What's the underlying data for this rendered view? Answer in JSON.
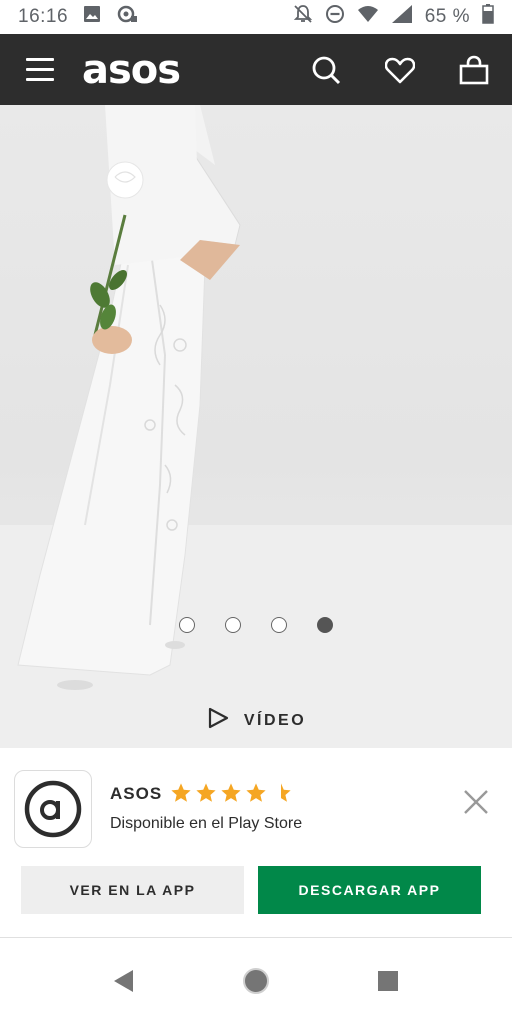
{
  "status_bar": {
    "time": "16:16",
    "battery": "65 %",
    "icons": [
      "image-icon",
      "sync-icon",
      "notifications-off-icon",
      "do-not-disturb-icon",
      "wifi-icon",
      "signal-icon",
      "battery-icon"
    ]
  },
  "header": {
    "brand": "asos",
    "icons": [
      "menu-icon",
      "search-icon",
      "heart-icon",
      "bag-icon"
    ],
    "background": "#2d2d2d"
  },
  "product": {
    "carousel": {
      "count": 4,
      "active_index": 3
    }
  },
  "video": {
    "label": "VÍDEO",
    "icon": "play-icon"
  },
  "app_banner": {
    "app_name": "ASOS",
    "rating": 4.5,
    "max_rating": 5,
    "subtitle": "Disponible en el Play Store",
    "secondary_button": "VER EN LA APP",
    "primary_button": "DESCARGAR APP",
    "accent_color": "#018849",
    "star_color": "#f5a623",
    "close_icon": "close-icon",
    "app_icon": "asos-a-logo-icon"
  },
  "nav_bar": {
    "icons": [
      "back-icon",
      "home-icon",
      "recents-icon"
    ]
  }
}
